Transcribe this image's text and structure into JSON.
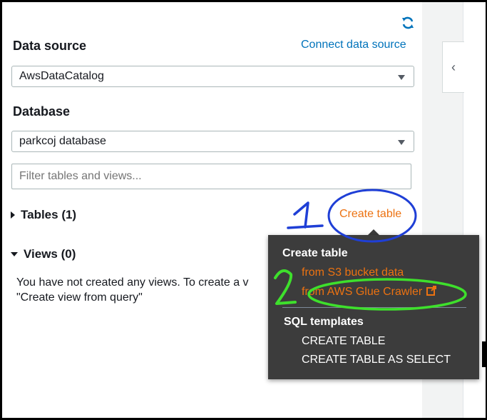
{
  "refresh_icon": "refresh-icon",
  "data_source": {
    "label": "Data source",
    "connect_link": "Connect data source",
    "selected": "AwsDataCatalog"
  },
  "database": {
    "label": "Database",
    "selected": "parkcoj database"
  },
  "filter": {
    "placeholder": "Filter tables and views..."
  },
  "tables": {
    "label": "Tables (1)",
    "create_link": "Create table"
  },
  "views": {
    "label": "Views (0)",
    "message_line1": "You have not created any views. To create a v",
    "message_line2": "\"Create view from query\""
  },
  "popup": {
    "create_heading": "Create table",
    "from_s3": "from S3 bucket data",
    "from_glue": "from AWS Glue Crawler",
    "sql_heading": "SQL templates",
    "create_table": "CREATE TABLE",
    "create_table_as_select": "CREATE TABLE AS SELECT"
  },
  "annotations": {
    "one": "1",
    "two": "2"
  },
  "colors": {
    "link_blue": "#0073bb",
    "accent_orange": "#ec7211",
    "popup_bg": "#3c3c3c",
    "annotation_blue": "#1f3fd6",
    "annotation_green": "#3ee02c"
  }
}
